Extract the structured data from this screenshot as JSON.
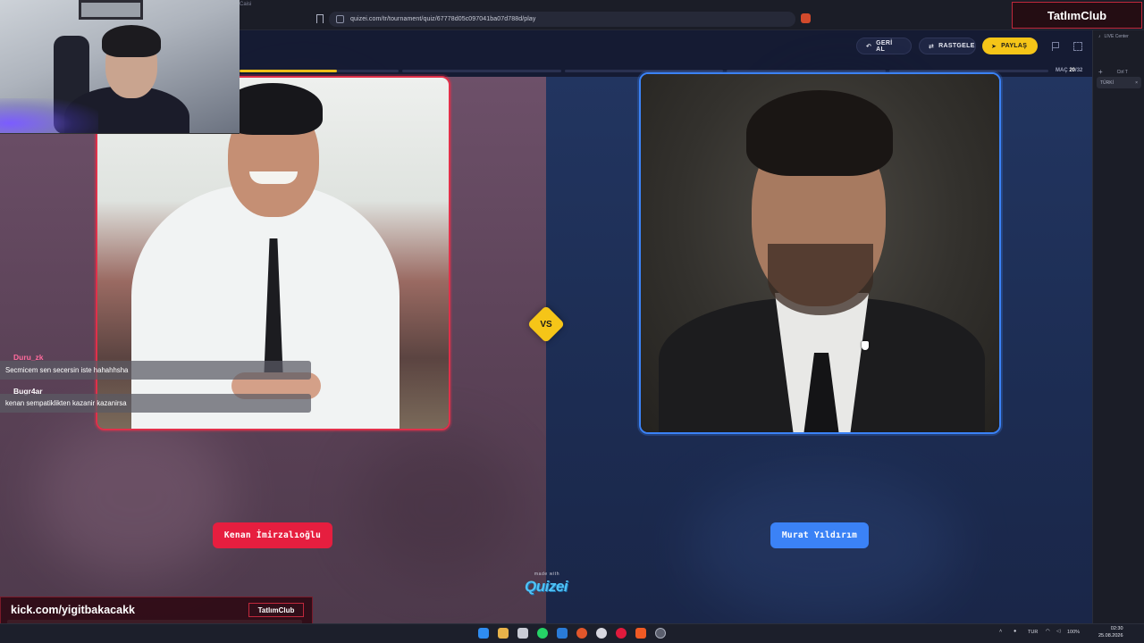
{
  "browser": {
    "tab_hint": "Caisi",
    "url": "quizei.com/tr/tournament/quiz/67778d05c097041ba07d788d/play"
  },
  "header": {
    "back_label": "GERİ AL",
    "random_label": "RASTGELE",
    "share_label": "PAYLAŞ",
    "match_prefix": "MAÇ",
    "match_current": "20",
    "match_total": "/32",
    "progress_fraction": 0.12
  },
  "side_panel": {
    "live_center": "LIVE Center",
    "tab_label": "TÜRKİ",
    "tab_close": "×",
    "plus": "+",
    "shortcut": "Ctrl T"
  },
  "matchup": {
    "left_name": "Kenan İmirzalıoğlu",
    "right_name": "Murat Yıldırım",
    "vs": "VS"
  },
  "branding": {
    "made_with": "made with",
    "logo": "Quizei",
    "stream_brand": "TatlımClub"
  },
  "chat": [
    {
      "user": "Duru_zk",
      "user_color": "#ff6b9d",
      "message": "Secmicem sen secersin iste hahahhsha"
    },
    {
      "user": "Bugr4ar",
      "user_color": "#ffffff",
      "message": "kenan sempatiklikten kazanir kazanirsa"
    }
  ],
  "stream": {
    "channel": "kick.com/yigitbakacakk",
    "tag": "TatlımClub"
  },
  "taskbar": {
    "lang": "TUR",
    "battery": "100%",
    "time": "02:30",
    "date": "25.08.2026"
  },
  "colors": {
    "accent_yellow": "#f5c518",
    "left_red": "#e61e3f",
    "right_blue": "#3b82f6"
  }
}
